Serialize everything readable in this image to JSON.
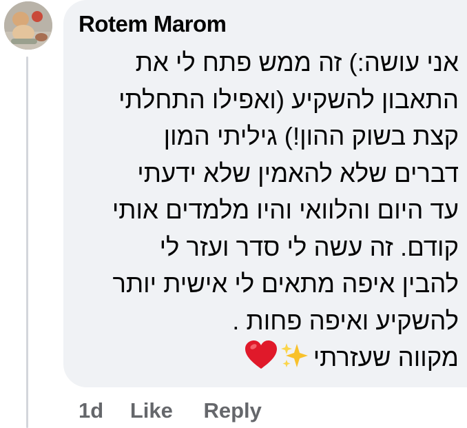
{
  "comment": {
    "author": "Rotem Marom",
    "avatar_icon": "profile-photo",
    "lines": [
      "אני עושה:) זה ממש פתח לי את",
      "התאבון להשקיע (ואפילו התחלתי",
      "קצת בשוק ההון!) גיליתי המון",
      "דברים שלא להאמין שלא ידעתי",
      "עד היום והלוואי והיו מלמדים אותי",
      "קודם. זה עשה לי סדר ועזר לי",
      "להבין איפה מתאים לי אישית יותר",
      "להשקיע ואיפה פחות ."
    ],
    "last_line_text": "מקווה שעזרתי",
    "emojis": [
      "sparkles-icon",
      "red-heart-icon"
    ]
  },
  "actions": {
    "time": "1d",
    "like": "Like",
    "reply": "Reply"
  },
  "colors": {
    "bubble_bg": "#f0f2f5",
    "text": "#050505",
    "secondary_text": "#65676b",
    "thread_line": "#d3d6db",
    "heart": "#e0192a",
    "sparkles": "#f8c12c"
  }
}
